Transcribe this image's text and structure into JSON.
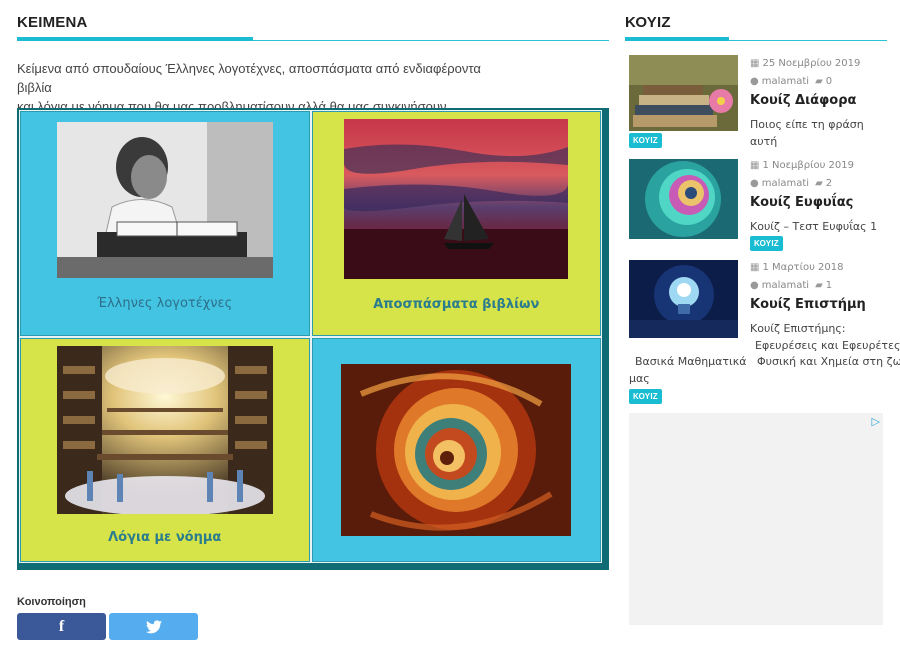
{
  "main": {
    "title": "ΚΕΙΜΕΝΑ",
    "intro_line1": "Κείμενα από σπουδαίους Έλληνες λογοτέχνες, αποσπάσματα από ενδιαφέροντα βιβλία",
    "intro_line2": "και λόγια με νόημα που θα μας προβληματίσουν αλλά θα μας συγκινήσουν.",
    "tiles": [
      {
        "caption": "Έλληνες λογοτέχνες",
        "image": "writer-photo"
      },
      {
        "caption": "Αποσπάσματα βιβλίων",
        "image": "sailboat-sunset"
      },
      {
        "caption": "Λόγια με νόημα",
        "image": "library-clouds"
      },
      {
        "caption": "",
        "image": "colour-swirl"
      }
    ],
    "share": {
      "label": "Κοινοποίηση",
      "facebook_icon": "facebook-icon",
      "twitter_icon": "twitter-icon"
    }
  },
  "sidebar": {
    "title": "ΚΟΥΙΖ",
    "quizzes": [
      {
        "date": "25 Νοεμβρίου 2019",
        "author": "malamati",
        "comments": "0",
        "title": "Κουίζ Διάφορα",
        "excerpt": "Ποιος είπε τη φράση αυτή",
        "badge": "ΚΟΥΙΖ",
        "image": "books-flower"
      },
      {
        "date": "1 Νοεμβρίου 2019",
        "author": "malamati",
        "comments": "2",
        "title": "Κουίζ Ευφυΐας",
        "excerpt": "Κουίζ – Τεστ Ευφυΐας 1",
        "badge": "ΚΟΥΙΖ",
        "image": "fractal-spiral"
      },
      {
        "date": "1 Μαρτίου 2018",
        "author": "malamati",
        "comments": "1",
        "title": "Κουίζ Επιστήμη",
        "excerpt_line1": "Κουίζ Επιστήμης:",
        "excerpt_line2": "Εφευρέσεις και Εφευρέτες",
        "excerpt_line3": "Βασικά Μαθηματικά   Φυσική και Χημεία στη ζωή",
        "excerpt_line4": "μας",
        "badge": "ΚΟΥΙΖ",
        "image": "light-bulb"
      }
    ],
    "ad": {
      "icon": "adchoices-icon"
    }
  }
}
